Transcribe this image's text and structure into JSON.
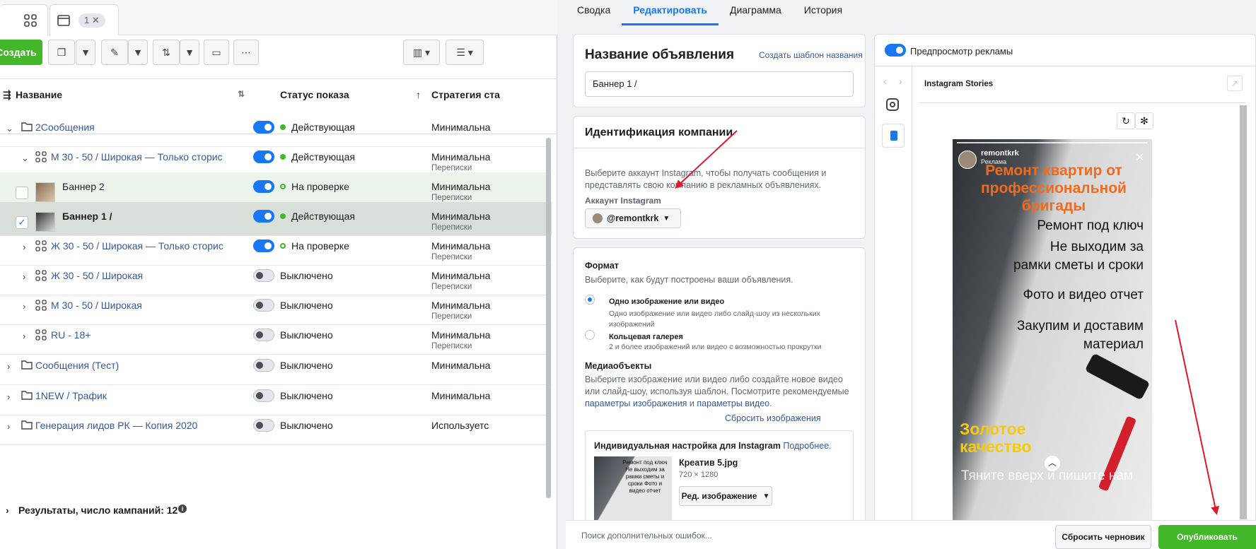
{
  "tabs": {
    "counter": "1"
  },
  "toolbar": {
    "create_label": "Создать"
  },
  "table": {
    "col_name": "Название",
    "col_status": "Статус показа",
    "col_strategy": "Стратегия ста",
    "rows": [
      {
        "name": "2Сообщения",
        "status": "Действующая",
        "strategy": "Минимальна",
        "sub": ""
      },
      {
        "name": "М 30 - 50 / Широкая — Только сторис",
        "status": "Действующая",
        "strategy": "Минимальна",
        "sub": "Переписки"
      },
      {
        "name": "Баннер 2",
        "status": "На проверке",
        "strategy": "Минимальна",
        "sub": "Переписки"
      },
      {
        "name": "Баннер 1 /",
        "status": "Действующая",
        "strategy": "Минимальна",
        "sub": "Переписки"
      },
      {
        "name": "Ж 30 - 50 / Широкая — Только сторис",
        "status": "На проверке",
        "strategy": "Минимальна",
        "sub": "Переписки"
      },
      {
        "name": "Ж 30 - 50 / Широкая",
        "status": "Выключено",
        "strategy": "Минимальна",
        "sub": "Переписки"
      },
      {
        "name": "М 30 - 50 / Широкая",
        "status": "Выключено",
        "strategy": "Минимальна",
        "sub": "Переписки"
      },
      {
        "name": "RU - 18+",
        "status": "Выключено",
        "strategy": "Минимальна",
        "sub": "Переписки"
      },
      {
        "name": "Сообщения (Тест)",
        "status": "Выключено",
        "strategy": "Минимальна",
        "sub": ""
      },
      {
        "name": "1NEW / Трафик",
        "status": "Выключено",
        "strategy": "Минимальна",
        "sub": ""
      },
      {
        "name": "Генерация лидов РК — Копия 2020",
        "status": "Выключено",
        "strategy": "Используетс",
        "sub": ""
      }
    ],
    "footer": "Результаты, число кампаний: 12"
  },
  "editor": {
    "tabs": [
      "Сводка",
      "Редактировать",
      "Диаграмма",
      "История"
    ],
    "ad_name_title": "Название объявления",
    "create_template": "Создать шаблон названия",
    "ad_name_value": "Баннер 1 /",
    "identity_title": "Идентификация компании",
    "identity_desc": "Выберите аккаунт Instagram, чтобы получать сообщения и представлять свою компанию в рекламных объявлениях.",
    "ig_account_label": "Аккаунт Instagram",
    "ig_account": "@remontkrk",
    "format_title": "Формат",
    "format_desc": "Выберите, как будут построены ваши объявления.",
    "opt1_title": "Одно изображение или видео",
    "opt1_desc": "Одно изображение или видео либо слайд-шоу из нескольких изображений",
    "opt2_title": "Кольцевая галерея",
    "opt2_desc": "2 и более изображений или видео с возможностью прокрутки",
    "media_title": "Медиаобъекты",
    "media_desc1": "Выберите изображение или видео либо создайте новое видео или слайд-шоу, используя шаблон. Посмотрите рекомендуемые ",
    "media_link1": "параметры изображения",
    "media_and": " и ",
    "media_link2": "параметры видео",
    "media_dot": ".",
    "reset_images": "Сбросить изображения",
    "ig_custom": "Индивидуальная настройка для Instagram",
    "more": "Подробнее.",
    "file_name": "Креатив 5.jpg",
    "file_size": "720 × 1280",
    "edit_image": "Ред. изображение"
  },
  "preview": {
    "toggle_label": "Предпросмотр рекламы",
    "placement": "Instagram Stories",
    "account": "remontkrk",
    "sponsored": "Реклама",
    "headline": "Ремонт квартир от профессиональной бригады",
    "l1": "Ремонт под ключ",
    "l2": "Не выходим за",
    "l3": "рамки сметы и сроки",
    "l4": "Фото и видео отчет",
    "l5": "Закупим и доставим",
    "l6": "материал",
    "gold": "Золотое качество",
    "bottom_text": "Тяните вверх и пишите нам",
    "thumb_text": "Ремонт под ключ Не выходим за рамки сметы и сроки Фото и видео отчет"
  },
  "bottom": {
    "errors": "Поиск дополнительных ошибок...",
    "discard": "Сбросить черновик",
    "publish": "Опубликовать"
  }
}
